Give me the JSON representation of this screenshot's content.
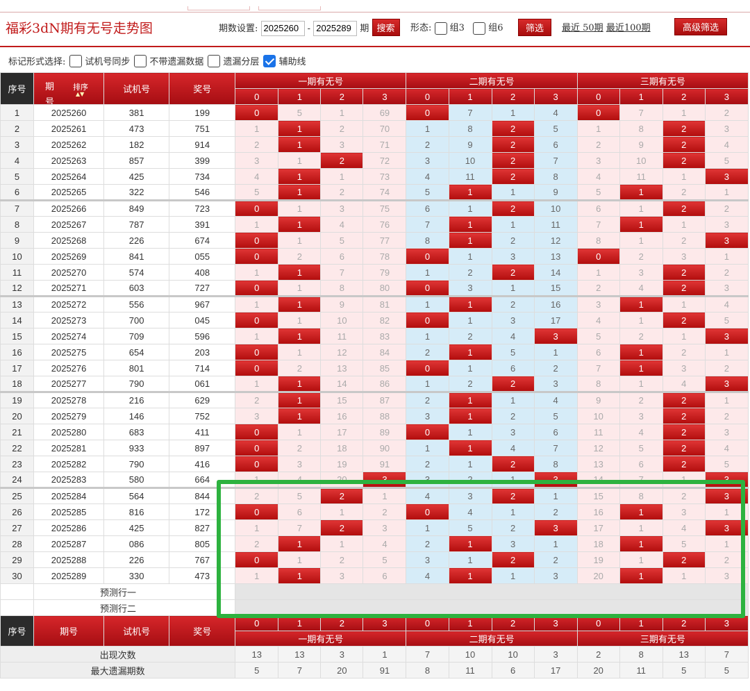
{
  "header": {
    "title": "福彩3dN期有无号走势图",
    "period_label": "期数设置:",
    "period_from": "2025260",
    "period_sep": "-",
    "period_to": "2025289",
    "period_unit": "期",
    "search_label": "搜索",
    "shape_label": "形态:",
    "group3_label": "组3",
    "group6_label": "组6",
    "filter_label": "筛选",
    "recent50_label": "最近 50期",
    "recent100_label": "最近100期",
    "advanced_label": "高级筛选"
  },
  "options": {
    "label": "标记形式选择:",
    "items": [
      {
        "label": "试机号同步",
        "checked": false
      },
      {
        "label": "不带遗漏数据",
        "checked": false
      },
      {
        "label": "遗漏分层",
        "checked": false
      },
      {
        "label": "辅助线",
        "checked": true
      }
    ]
  },
  "table": {
    "col_index": "序号",
    "col_period": "期号",
    "col_sort": "排序",
    "col_trial": "试机号",
    "col_prize": "奖号",
    "group_names": [
      "一期有无号",
      "二期有无号",
      "三期有无号"
    ],
    "sub_labels": [
      "0",
      "1",
      "2",
      "3"
    ],
    "rows": [
      {
        "idx": "1",
        "period": "2025260",
        "trial": "381",
        "prize": "199",
        "g": [
          [
            0,
            5,
            1,
            69
          ],
          [
            0,
            7,
            1,
            4
          ],
          [
            0,
            7,
            1,
            2
          ]
        ],
        "h": [
          0,
          0,
          0
        ]
      },
      {
        "idx": "2",
        "period": "2025261",
        "trial": "473",
        "prize": "751",
        "g": [
          [
            1,
            1,
            2,
            70
          ],
          [
            1,
            8,
            2,
            5
          ],
          [
            1,
            8,
            2,
            3
          ]
        ],
        "h": [
          1,
          2,
          2
        ]
      },
      {
        "idx": "3",
        "period": "2025262",
        "trial": "182",
        "prize": "914",
        "g": [
          [
            2,
            1,
            3,
            71
          ],
          [
            2,
            9,
            2,
            6
          ],
          [
            2,
            9,
            2,
            4
          ]
        ],
        "h": [
          1,
          2,
          2
        ]
      },
      {
        "idx": "4",
        "period": "2025263",
        "trial": "857",
        "prize": "399",
        "g": [
          [
            3,
            1,
            2,
            72
          ],
          [
            3,
            10,
            2,
            7
          ],
          [
            3,
            10,
            2,
            5
          ]
        ],
        "h": [
          2,
          2,
          2
        ]
      },
      {
        "idx": "5",
        "period": "2025264",
        "trial": "425",
        "prize": "734",
        "g": [
          [
            4,
            1,
            1,
            73
          ],
          [
            4,
            11,
            2,
            8
          ],
          [
            4,
            11,
            1,
            3
          ]
        ],
        "h": [
          1,
          2,
          3
        ]
      },
      {
        "idx": "6",
        "period": "2025265",
        "trial": "322",
        "prize": "546",
        "g": [
          [
            5,
            1,
            2,
            74
          ],
          [
            5,
            1,
            1,
            9
          ],
          [
            5,
            1,
            2,
            1
          ]
        ],
        "h": [
          1,
          1,
          1
        ]
      },
      {
        "idx": "7",
        "period": "2025266",
        "trial": "849",
        "prize": "723",
        "g": [
          [
            0,
            1,
            3,
            75
          ],
          [
            6,
            1,
            2,
            10
          ],
          [
            6,
            1,
            2,
            2
          ]
        ],
        "h": [
          0,
          2,
          2
        ]
      },
      {
        "idx": "8",
        "period": "2025267",
        "trial": "787",
        "prize": "391",
        "g": [
          [
            1,
            1,
            4,
            76
          ],
          [
            7,
            1,
            1,
            11
          ],
          [
            7,
            1,
            1,
            3
          ]
        ],
        "h": [
          1,
          1,
          1
        ]
      },
      {
        "idx": "9",
        "period": "2025268",
        "trial": "226",
        "prize": "674",
        "g": [
          [
            0,
            1,
            5,
            77
          ],
          [
            8,
            1,
            2,
            12
          ],
          [
            8,
            1,
            2,
            3
          ]
        ],
        "h": [
          0,
          1,
          3
        ]
      },
      {
        "idx": "10",
        "period": "2025269",
        "trial": "841",
        "prize": "055",
        "g": [
          [
            0,
            2,
            6,
            78
          ],
          [
            0,
            1,
            3,
            13
          ],
          [
            0,
            2,
            3,
            1
          ]
        ],
        "h": [
          0,
          0,
          0
        ]
      },
      {
        "idx": "11",
        "period": "2025270",
        "trial": "574",
        "prize": "408",
        "g": [
          [
            1,
            1,
            7,
            79
          ],
          [
            1,
            2,
            2,
            14
          ],
          [
            1,
            3,
            2,
            2
          ]
        ],
        "h": [
          1,
          2,
          2
        ]
      },
      {
        "idx": "12",
        "period": "2025271",
        "trial": "603",
        "prize": "727",
        "g": [
          [
            0,
            1,
            8,
            80
          ],
          [
            0,
            3,
            1,
            15
          ],
          [
            2,
            4,
            2,
            3
          ]
        ],
        "h": [
          0,
          0,
          2
        ]
      },
      {
        "idx": "13",
        "period": "2025272",
        "trial": "556",
        "prize": "967",
        "g": [
          [
            1,
            1,
            9,
            81
          ],
          [
            1,
            1,
            2,
            16
          ],
          [
            3,
            1,
            1,
            4
          ]
        ],
        "h": [
          1,
          1,
          1
        ]
      },
      {
        "idx": "14",
        "period": "2025273",
        "trial": "700",
        "prize": "045",
        "g": [
          [
            0,
            1,
            10,
            82
          ],
          [
            0,
            1,
            3,
            17
          ],
          [
            4,
            1,
            2,
            5
          ]
        ],
        "h": [
          0,
          0,
          2
        ]
      },
      {
        "idx": "15",
        "period": "2025274",
        "trial": "709",
        "prize": "596",
        "g": [
          [
            1,
            1,
            11,
            83
          ],
          [
            1,
            2,
            4,
            3
          ],
          [
            5,
            2,
            1,
            3
          ]
        ],
        "h": [
          1,
          3,
          3
        ]
      },
      {
        "idx": "16",
        "period": "2025275",
        "trial": "654",
        "prize": "203",
        "g": [
          [
            0,
            1,
            12,
            84
          ],
          [
            2,
            1,
            5,
            1
          ],
          [
            6,
            1,
            2,
            1
          ]
        ],
        "h": [
          0,
          1,
          1
        ]
      },
      {
        "idx": "17",
        "period": "2025276",
        "trial": "801",
        "prize": "714",
        "g": [
          [
            0,
            2,
            13,
            85
          ],
          [
            0,
            1,
            6,
            2
          ],
          [
            7,
            1,
            3,
            2
          ]
        ],
        "h": [
          0,
          0,
          1
        ]
      },
      {
        "idx": "18",
        "period": "2025277",
        "trial": "790",
        "prize": "061",
        "g": [
          [
            1,
            1,
            14,
            86
          ],
          [
            1,
            2,
            2,
            3
          ],
          [
            8,
            1,
            4,
            3
          ]
        ],
        "h": [
          1,
          2,
          3
        ]
      },
      {
        "idx": "19",
        "period": "2025278",
        "trial": "216",
        "prize": "629",
        "g": [
          [
            2,
            1,
            15,
            87
          ],
          [
            2,
            1,
            1,
            4
          ],
          [
            9,
            2,
            2,
            1
          ]
        ],
        "h": [
          1,
          1,
          2
        ]
      },
      {
        "idx": "20",
        "period": "2025279",
        "trial": "146",
        "prize": "752",
        "g": [
          [
            3,
            1,
            16,
            88
          ],
          [
            3,
            1,
            2,
            5
          ],
          [
            10,
            3,
            2,
            2
          ]
        ],
        "h": [
          1,
          1,
          2
        ]
      },
      {
        "idx": "21",
        "period": "2025280",
        "trial": "683",
        "prize": "411",
        "g": [
          [
            0,
            1,
            17,
            89
          ],
          [
            0,
            1,
            3,
            6
          ],
          [
            11,
            4,
            2,
            3
          ]
        ],
        "h": [
          0,
          0,
          2
        ]
      },
      {
        "idx": "22",
        "period": "2025281",
        "trial": "933",
        "prize": "897",
        "g": [
          [
            0,
            2,
            18,
            90
          ],
          [
            1,
            1,
            4,
            7
          ],
          [
            12,
            5,
            2,
            4
          ]
        ],
        "h": [
          0,
          1,
          2
        ]
      },
      {
        "idx": "23",
        "period": "2025282",
        "trial": "790",
        "prize": "416",
        "g": [
          [
            0,
            3,
            19,
            91
          ],
          [
            2,
            1,
            2,
            8
          ],
          [
            13,
            6,
            2,
            5
          ]
        ],
        "h": [
          0,
          2,
          2
        ]
      },
      {
        "idx": "24",
        "period": "2025283",
        "trial": "580",
        "prize": "664",
        "g": [
          [
            1,
            4,
            20,
            3
          ],
          [
            3,
            2,
            1,
            3
          ],
          [
            14,
            7,
            1,
            3
          ]
        ],
        "h": [
          3,
          3,
          3
        ]
      },
      {
        "idx": "25",
        "period": "2025284",
        "trial": "564",
        "prize": "844",
        "g": [
          [
            2,
            5,
            2,
            1
          ],
          [
            4,
            3,
            2,
            1
          ],
          [
            15,
            8,
            2,
            3
          ]
        ],
        "h": [
          2,
          2,
          3
        ]
      },
      {
        "idx": "26",
        "period": "2025285",
        "trial": "816",
        "prize": "172",
        "g": [
          [
            0,
            6,
            1,
            2
          ],
          [
            0,
            4,
            1,
            2
          ],
          [
            16,
            1,
            3,
            1
          ]
        ],
        "h": [
          0,
          0,
          1
        ]
      },
      {
        "idx": "27",
        "period": "2025286",
        "trial": "425",
        "prize": "827",
        "g": [
          [
            1,
            7,
            2,
            3
          ],
          [
            1,
            5,
            2,
            3
          ],
          [
            17,
            1,
            4,
            3
          ]
        ],
        "h": [
          2,
          3,
          3
        ]
      },
      {
        "idx": "28",
        "period": "2025287",
        "trial": "086",
        "prize": "805",
        "g": [
          [
            2,
            1,
            1,
            4
          ],
          [
            2,
            1,
            3,
            1
          ],
          [
            18,
            1,
            5,
            1
          ]
        ],
        "h": [
          1,
          1,
          1
        ]
      },
      {
        "idx": "29",
        "period": "2025288",
        "trial": "226",
        "prize": "767",
        "g": [
          [
            0,
            1,
            2,
            5
          ],
          [
            3,
            1,
            2,
            2
          ],
          [
            19,
            1,
            2,
            2
          ]
        ],
        "h": [
          0,
          2,
          2
        ]
      },
      {
        "idx": "30",
        "period": "2025289",
        "trial": "330",
        "prize": "473",
        "g": [
          [
            1,
            1,
            3,
            6
          ],
          [
            4,
            1,
            1,
            3
          ],
          [
            20,
            1,
            1,
            3
          ]
        ],
        "h": [
          1,
          1,
          1
        ]
      }
    ],
    "predict_rows": [
      "预测行一",
      "预测行二"
    ],
    "stats": [
      {
        "label": "出现次数",
        "values": [
          "13",
          "13",
          "3",
          "1",
          "7",
          "10",
          "10",
          "3",
          "2",
          "8",
          "13",
          "7"
        ]
      },
      {
        "label": "最大遗漏期数",
        "values": [
          "5",
          "7",
          "20",
          "91",
          "8",
          "11",
          "6",
          "17",
          "20",
          "11",
          "5",
          "5"
        ]
      }
    ]
  },
  "colors": {
    "accent_red": "#c11b1b",
    "annotation_green": "#2db23f",
    "blue_band": "#d6ecf8",
    "pink_band": "#fde9ea"
  }
}
